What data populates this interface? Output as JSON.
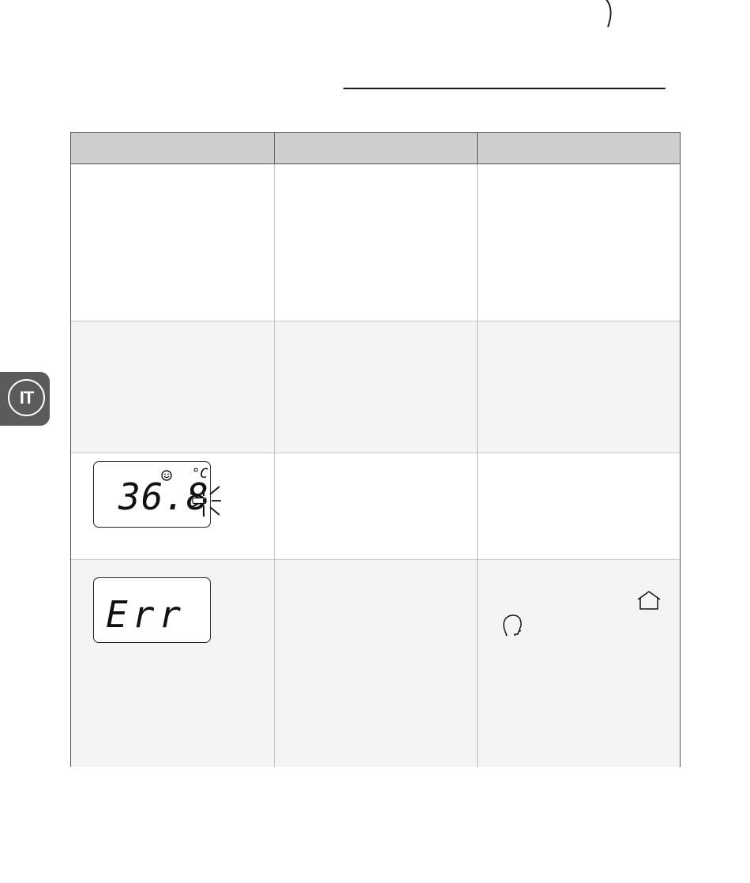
{
  "language_tab": {
    "code": "IT"
  },
  "icons": {
    "smile": "smiley-face-icon",
    "beep": "beep-signal-icon",
    "home": "home-icon",
    "head": "head-profile-icon"
  },
  "displays": {
    "reading": {
      "value": "36.8",
      "unit": "°C"
    },
    "error": {
      "code": "Err"
    }
  }
}
